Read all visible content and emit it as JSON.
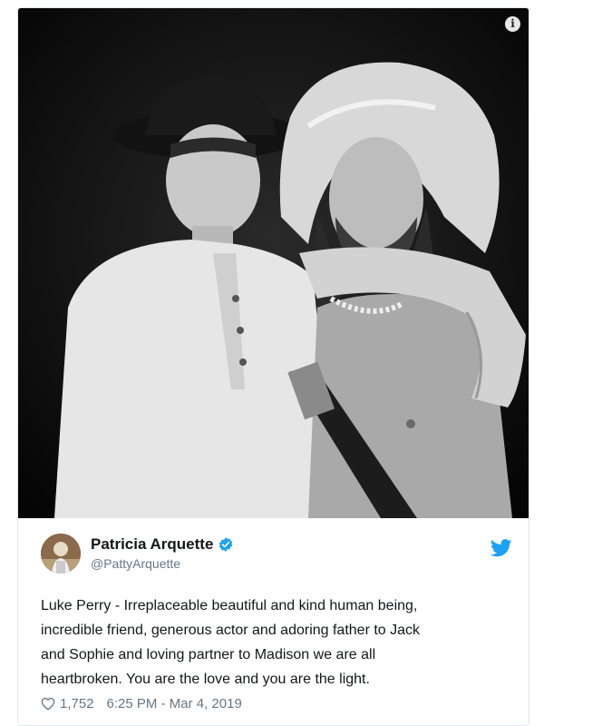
{
  "tweet": {
    "display_name": "Patricia Arquette",
    "handle": "@PattyArquette",
    "text_lines": [
      "Luke Perry - Irreplaceable beautiful and kind human being,",
      "incredible friend, generous actor and adoring father to Jack",
      "and Sophie and loving partner to Madison we are all",
      "heartbroken. You are the love and you are the light."
    ],
    "likes": "1,752",
    "timestamp": "6:25 PM - Mar 4, 2019"
  },
  "icons": {
    "info": "info-icon",
    "verified": "verified-badge-icon",
    "bird": "twitter-bird-icon",
    "heart": "heart-icon"
  },
  "colors": {
    "verified": "#1da1f2",
    "bird": "#1da1f2",
    "muted_text": "#657786"
  }
}
